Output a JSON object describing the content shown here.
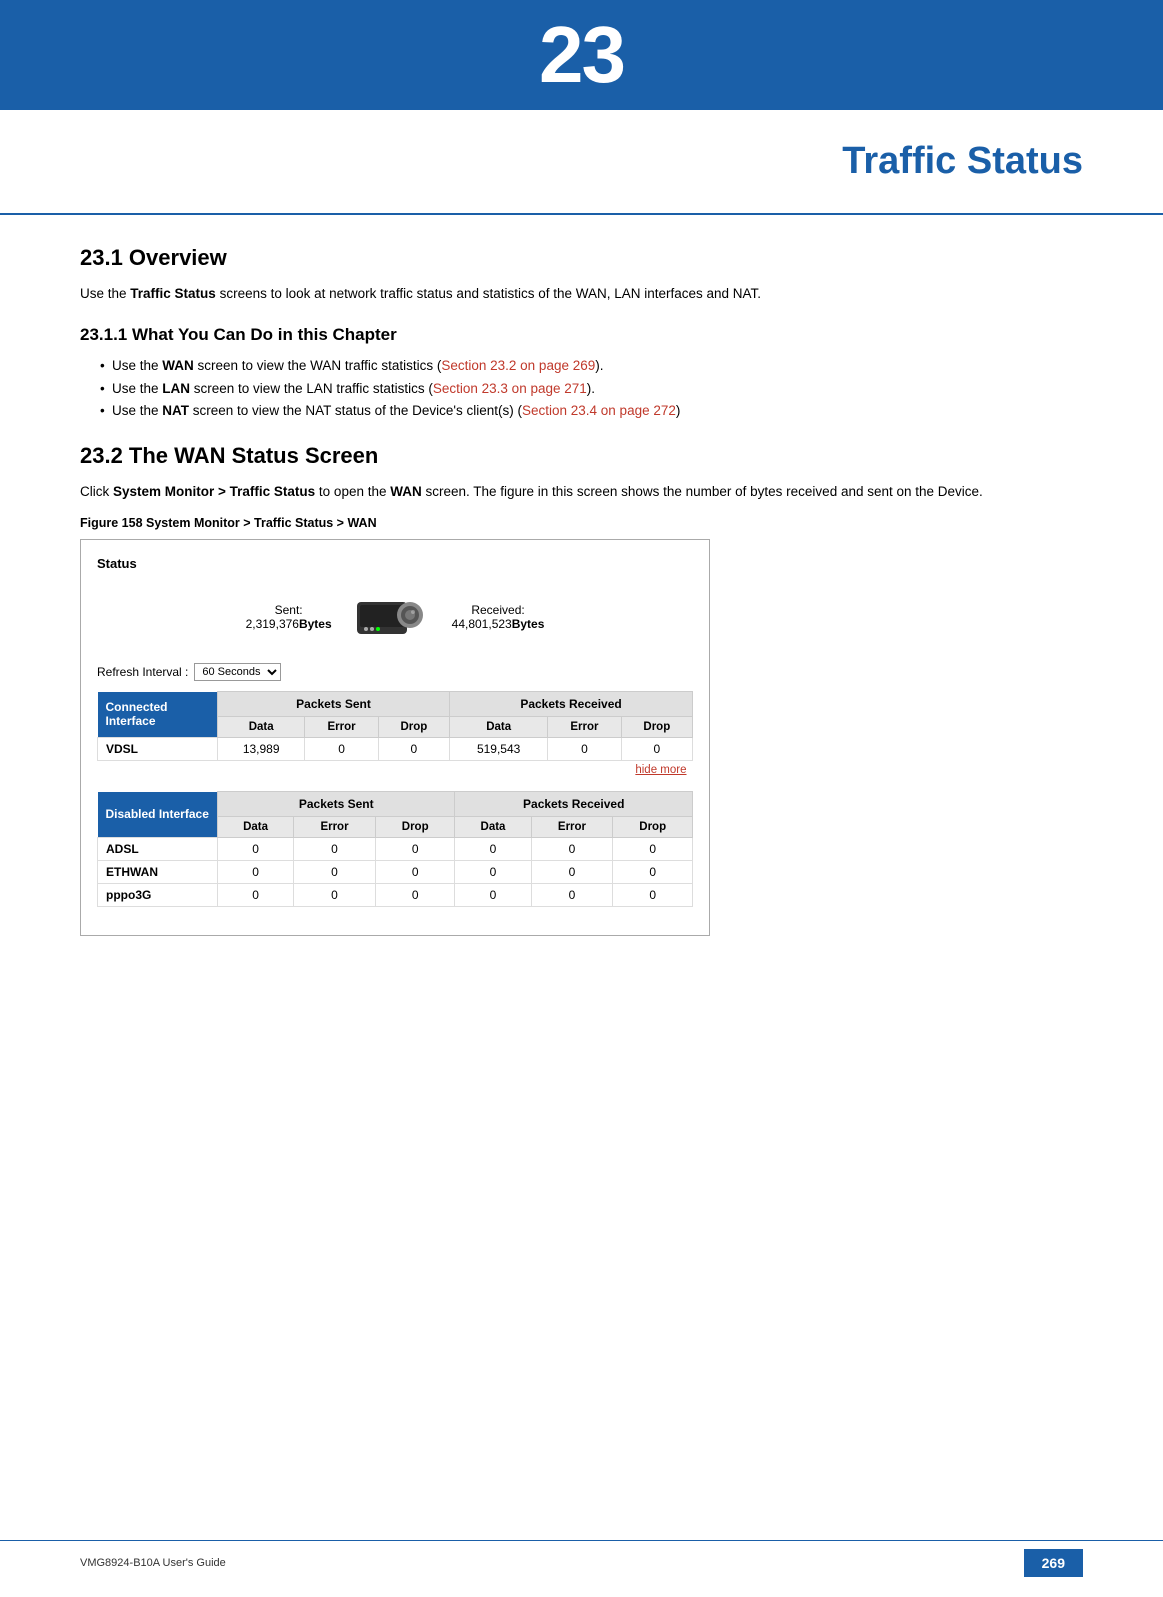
{
  "top_bar": {
    "chapter_number": "23"
  },
  "chapter_title": "Traffic Status",
  "sections": {
    "overview": {
      "heading": "23.1  Overview",
      "body": "Use the Traffic Status screens to look at network traffic status and statistics of the WAN, LAN interfaces and NAT."
    },
    "what_you_can_do": {
      "heading": "23.1.1  What You Can Do in this Chapter",
      "items": [
        {
          "text_before": "Use the ",
          "bold": "WAN",
          "text_after": " screen to view the WAN traffic statistics (",
          "link_text": "Section 23.2 on page 269",
          "text_end": ")."
        },
        {
          "text_before": "Use the ",
          "bold": "LAN",
          "text_after": " screen to view the LAN traffic statistics (",
          "link_text": "Section 23.3 on page 271",
          "text_end": ")."
        },
        {
          "text_before": "Use the ",
          "bold": "NAT",
          "text_after": " screen to view the NAT status of the Device’s client(s) (",
          "link_text": "Section 23.4 on page 272",
          "text_end": ")"
        }
      ]
    },
    "wan_status": {
      "heading": "23.2  The WAN Status Screen",
      "body_before": "Click ",
      "bold": "System Monitor > Traffic Status",
      "body_after": " to open the ",
      "bold2": "WAN",
      "body_end": " screen. The figure in this screen shows the number of bytes received and sent on the Device.",
      "figure_caption": "Figure 158",
      "figure_caption_desc": "  System Monitor > Traffic Status > WAN"
    }
  },
  "screenshot": {
    "status_label": "Status",
    "sent_label": "Sent:",
    "sent_value": "2,319,376",
    "sent_unit": "Bytes",
    "received_label": "Received:",
    "received_value": "44,801,523",
    "received_unit": "Bytes",
    "refresh_label": "Refresh Interval :",
    "refresh_value": "60 Seconds",
    "connected_interface_label": "Connected Interface",
    "packets_sent_label": "Packets Sent",
    "packets_received_label": "Packets Received",
    "col_headers": [
      "Data",
      "Error",
      "Drop",
      "Data",
      "Error",
      "Drop"
    ],
    "connected_rows": [
      {
        "interface": "VDSL",
        "data_sent": "13,989",
        "error_sent": "0",
        "drop_sent": "0",
        "data_recv": "519,543",
        "error_recv": "0",
        "drop_recv": "0"
      }
    ],
    "hide_more": "hide more",
    "disabled_interface_label": "Disabled Interface",
    "disabled_rows": [
      {
        "interface": "ADSL",
        "data_sent": "0",
        "error_sent": "0",
        "drop_sent": "0",
        "data_recv": "0",
        "error_recv": "0",
        "drop_recv": "0"
      },
      {
        "interface": "ETHWAN",
        "data_sent": "0",
        "error_sent": "0",
        "drop_sent": "0",
        "data_recv": "0",
        "error_recv": "0",
        "drop_recv": "0"
      },
      {
        "interface": "pppo3G",
        "data_sent": "0",
        "error_sent": "0",
        "drop_sent": "0",
        "data_recv": "0",
        "error_recv": "0",
        "drop_recv": "0"
      }
    ]
  },
  "footer": {
    "left": "VMG8924-B10A User's Guide",
    "right": "269"
  }
}
